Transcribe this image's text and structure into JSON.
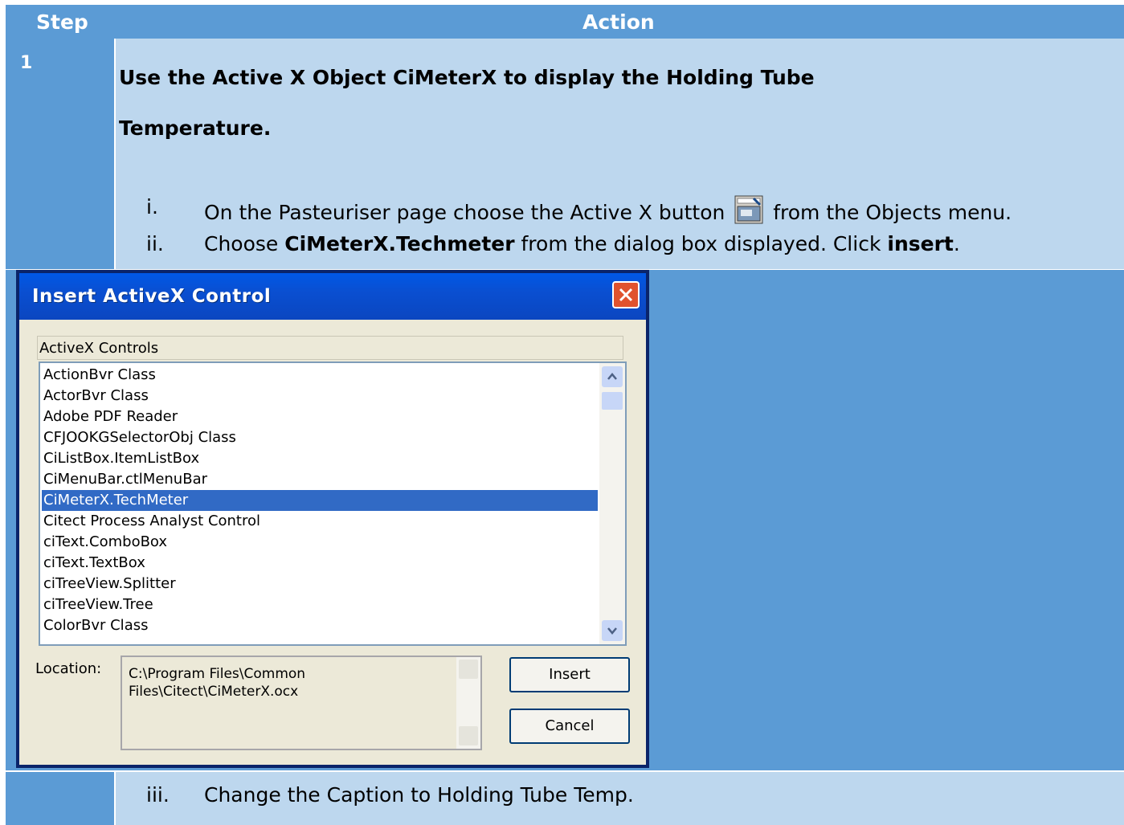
{
  "table": {
    "header_step": "Step",
    "header_action": "Action",
    "step_number": "1",
    "title_line1": "Use the Active X Object CiMeterX to display the Holding Tube",
    "title_line2": "Temperature.",
    "steps": [
      {
        "numeral": "i.",
        "before": "On the Pasteuriser page choose the Active X button",
        "after": "from the Objects menu."
      },
      {
        "numeral": "ii.",
        "pre": "Choose ",
        "bold1": "CiMeterX.Techmeter",
        "mid": " from the dialog box displayed. Click ",
        "bold2": "insert",
        "post": "."
      },
      {
        "numeral": "iii.",
        "text": "Change the Caption to Holding Tube Temp."
      }
    ]
  },
  "dialog": {
    "title": "Insert ActiveX Control",
    "group_label": "ActiveX Controls",
    "items": [
      "ActionBvr Class",
      "ActorBvr Class",
      "Adobe PDF Reader",
      "CFJOOKGSelectorObj Class",
      "CiListBox.ItemListBox",
      "CiMenuBar.ctlMenuBar",
      "CiMeterX.TechMeter",
      "Citect Process Analyst Control",
      "ciText.ComboBox",
      "ciText.TextBox",
      "ciTreeView.Splitter",
      "ciTreeView.Tree",
      "ColorBvr Class"
    ],
    "selected_index": 6,
    "location_label": "Location:",
    "location_value": "C:\\Program Files\\Common Files\\Citect\\CiMeterX.ocx",
    "insert_label": "Insert",
    "cancel_label": "Cancel"
  },
  "icons": [
    "activex-button-icon",
    "close-icon",
    "scroll-up-icon",
    "scroll-down-icon"
  ],
  "colors": {
    "header_blue": "#5b9bd5",
    "light_blue": "#bdd7ee",
    "xp_title": "#0a4fd1",
    "selection": "#316ac5",
    "dialog_face": "#ece9d8"
  }
}
